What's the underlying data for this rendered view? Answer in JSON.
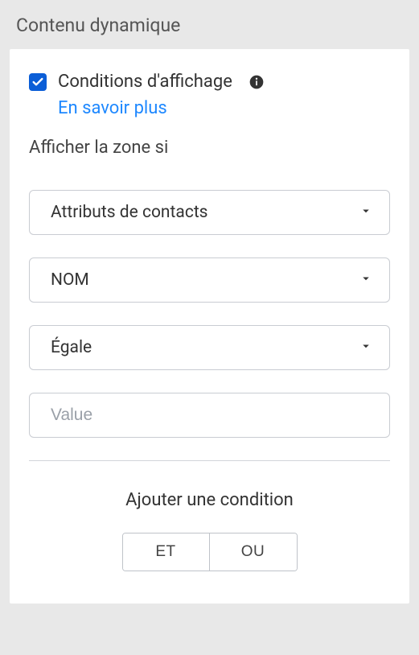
{
  "header": {
    "title": "Contenu dynamique"
  },
  "conditions": {
    "checkbox_checked": true,
    "label": "Conditions d'affichage",
    "learn_more": "En savoir plus"
  },
  "show_zone_label": "Afficher la zone si",
  "selects": {
    "attribute_source": "Attributs de contacts",
    "attribute_name": "NOM",
    "operator": "Égale"
  },
  "value_input": {
    "placeholder": "Value",
    "value": ""
  },
  "add_condition": {
    "label": "Ajouter une condition",
    "and": "ET",
    "or": "OU"
  }
}
